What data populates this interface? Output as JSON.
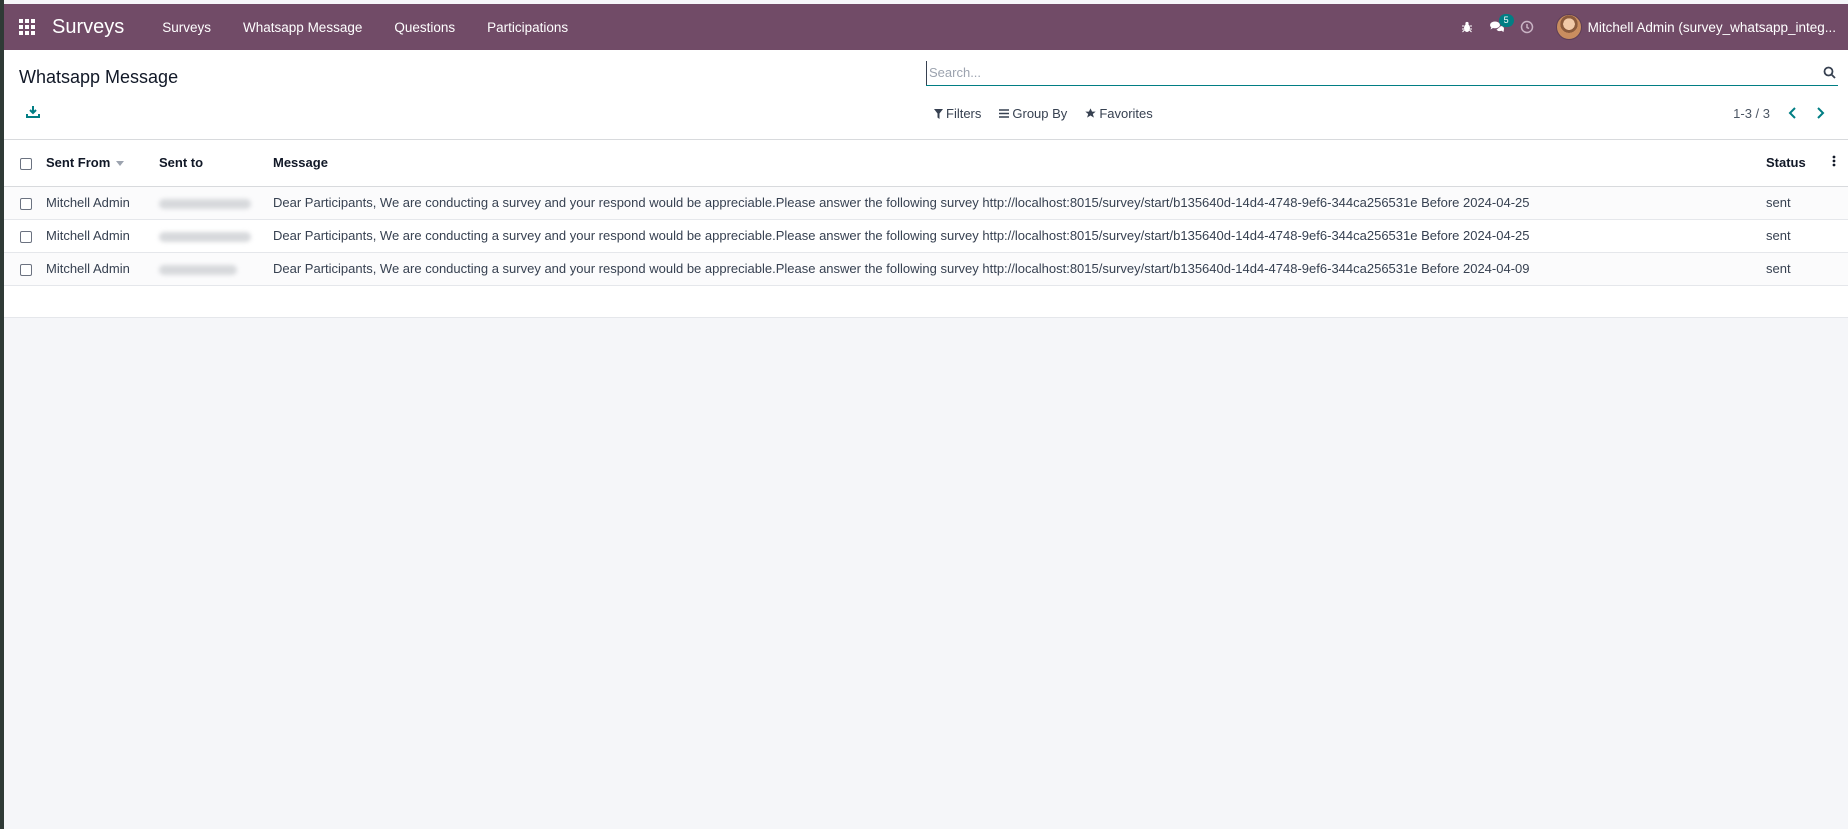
{
  "navbar": {
    "brand": "Surveys",
    "menu": [
      "Surveys",
      "Whatsapp Message",
      "Questions",
      "Participations"
    ],
    "messages_badge": "5",
    "user_name": "Mitchell Admin (survey_whatsapp_integ..."
  },
  "control_panel": {
    "title": "Whatsapp Message",
    "search_placeholder": "Search...",
    "filters_label": "Filters",
    "groupby_label": "Group By",
    "favorites_label": "Favorites",
    "pager": "1-3 / 3"
  },
  "table": {
    "headers": {
      "sent_from": "Sent From",
      "sent_to": "Sent to",
      "message": "Message",
      "status": "Status"
    },
    "rows": [
      {
        "sent_from": "Mitchell Admin",
        "message": "Dear Participants, We are conducting a survey and your respond would be appreciable.Please answer the following survey http://localhost:8015/survey/start/b135640d-14d4-4748-9ef6-344ca256531e Before 2024-04-25",
        "status": "sent"
      },
      {
        "sent_from": "Mitchell Admin",
        "message": "Dear Participants, We are conducting a survey and your respond would be appreciable.Please answer the following survey http://localhost:8015/survey/start/b135640d-14d4-4748-9ef6-344ca256531e Before 2024-04-25",
        "status": "sent"
      },
      {
        "sent_from": "Mitchell Admin",
        "message": "Dear Participants, We are conducting a survey and your respond would be appreciable.Please answer the following survey http://localhost:8015/survey/start/b135640d-14d4-4748-9ef6-344ca256531e Before 2024-04-09",
        "status": "sent"
      }
    ]
  },
  "colors": {
    "navbar": "#714b67",
    "accent": "#017e84"
  }
}
